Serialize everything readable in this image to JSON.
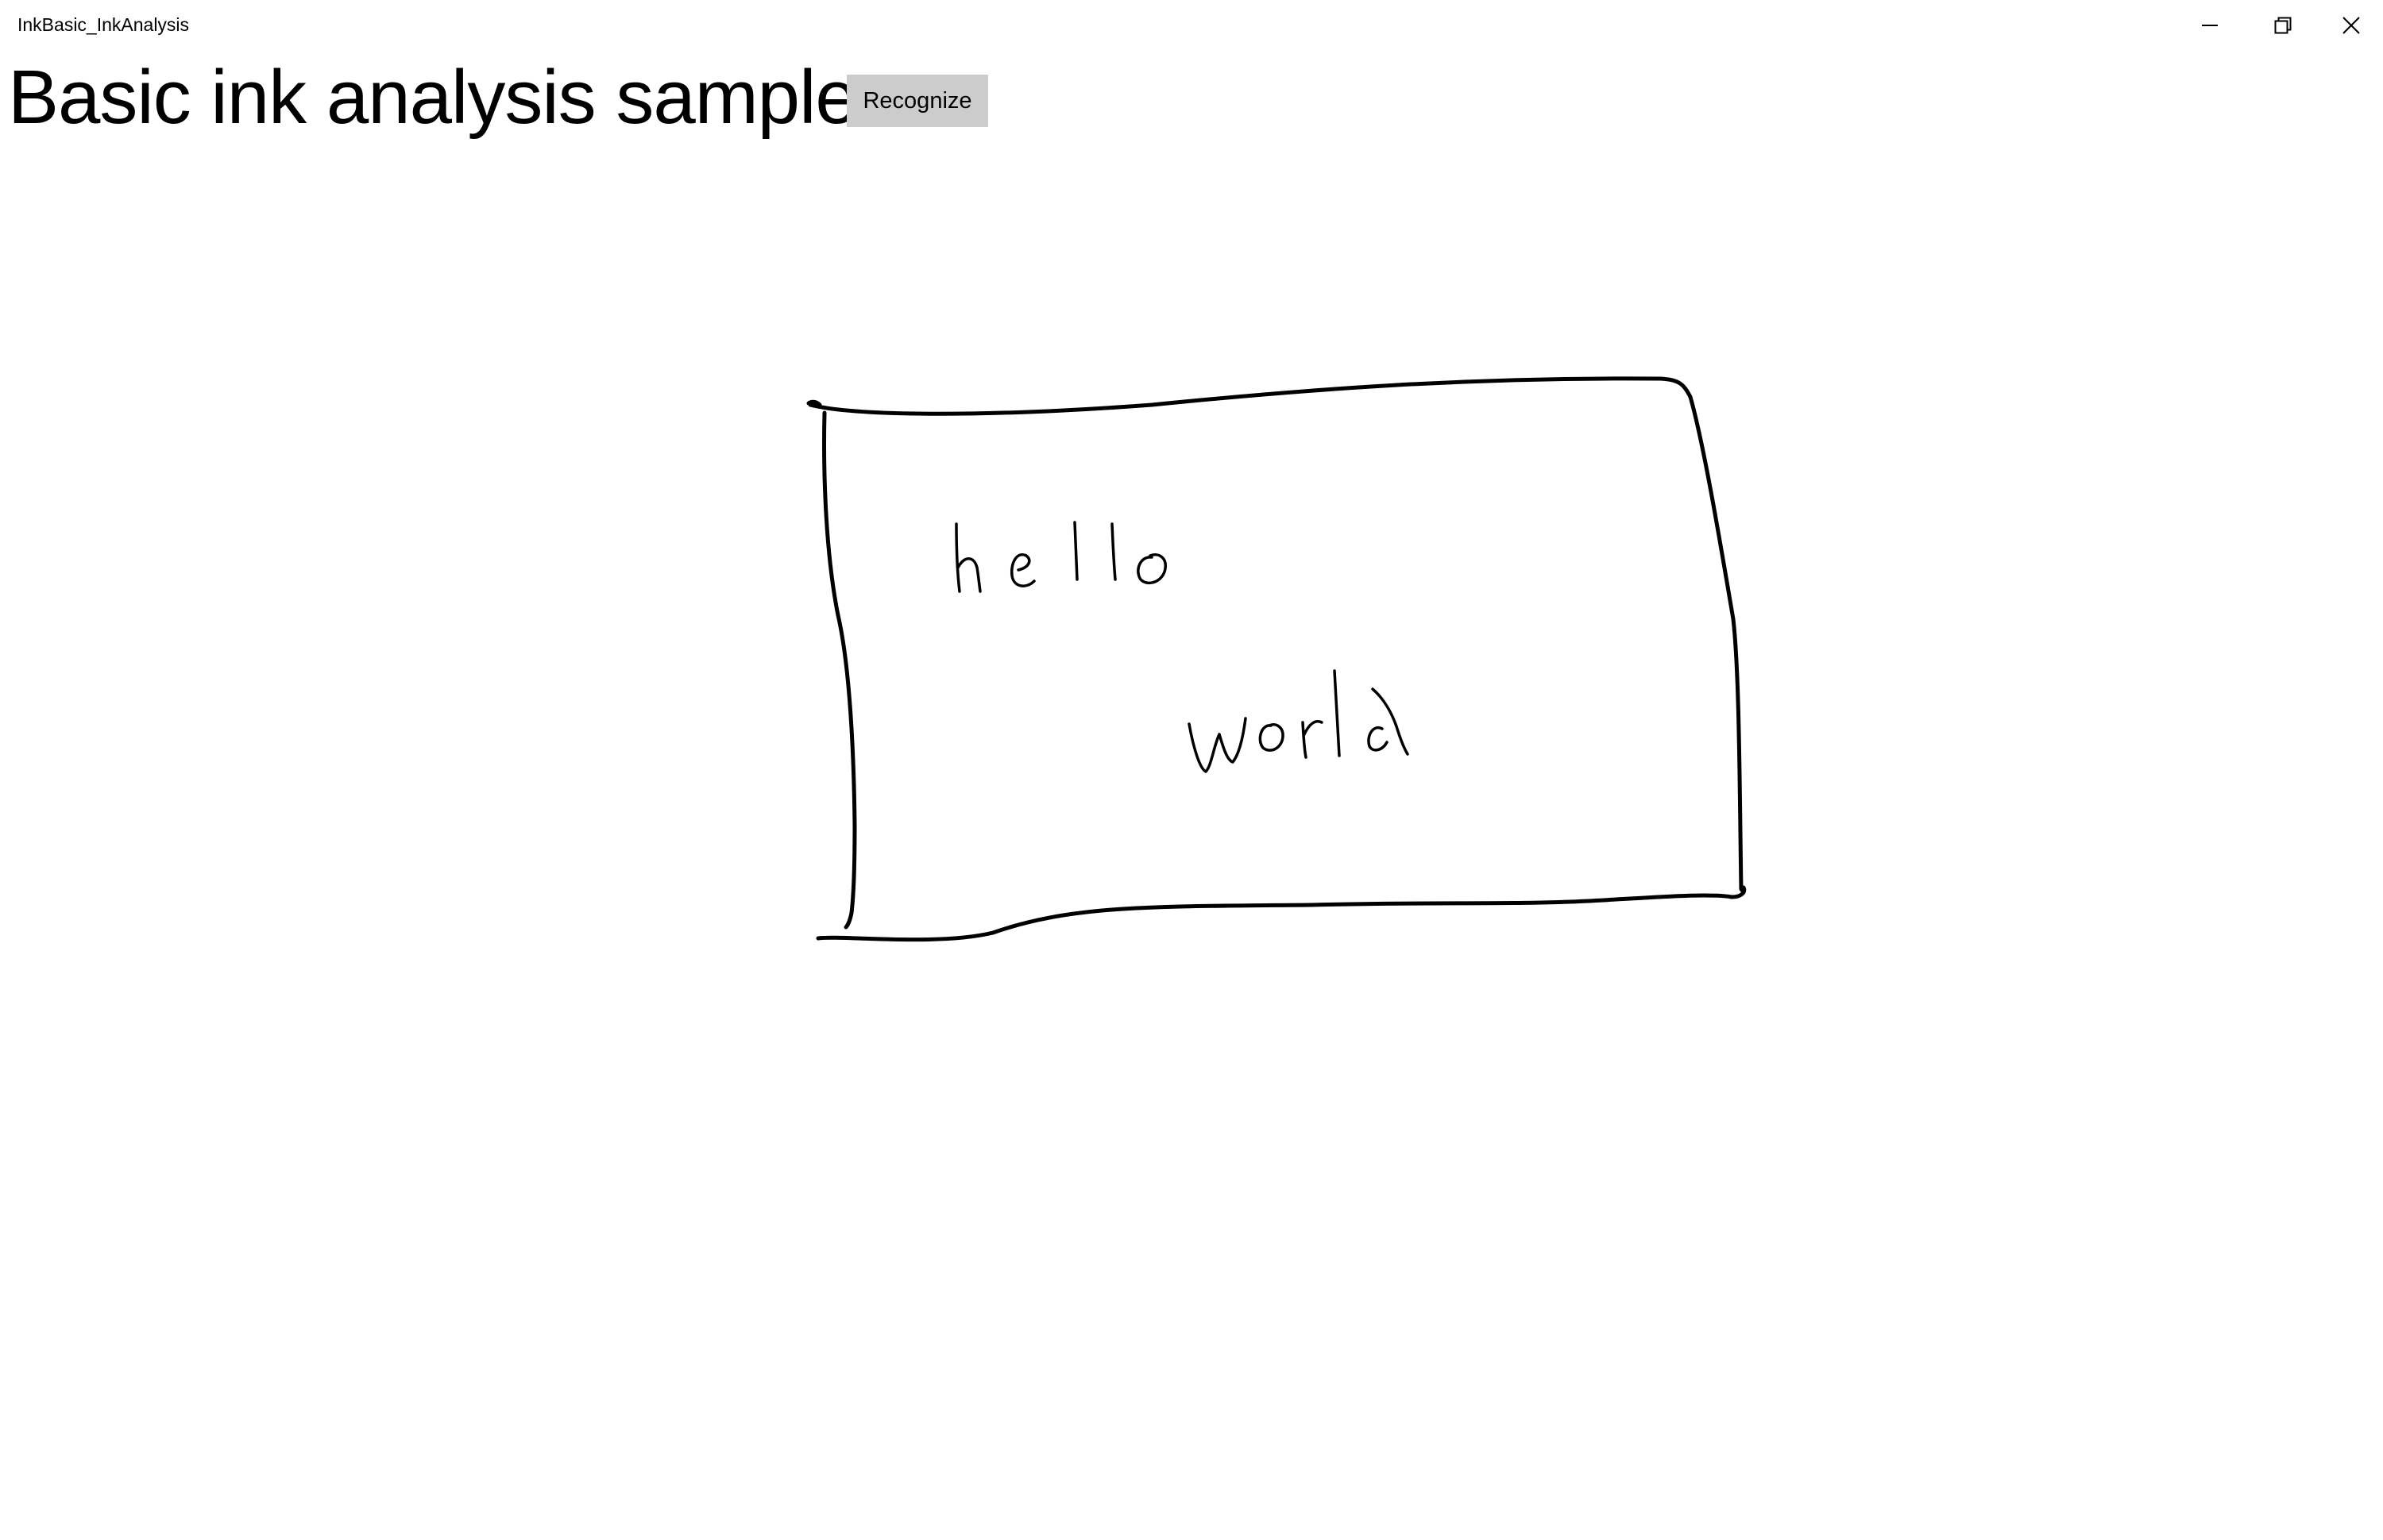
{
  "window": {
    "title": "InkBasic_InkAnalysis",
    "controls": {
      "minimize": "minimize-icon",
      "restore": "restore-icon",
      "close": "close-icon"
    }
  },
  "header": {
    "title": "Basic ink analysis sample",
    "recognize_label": "Recognize"
  },
  "colors": {
    "background": "#ffffff",
    "button_bg": "#cccccc",
    "ink": "#000000"
  }
}
